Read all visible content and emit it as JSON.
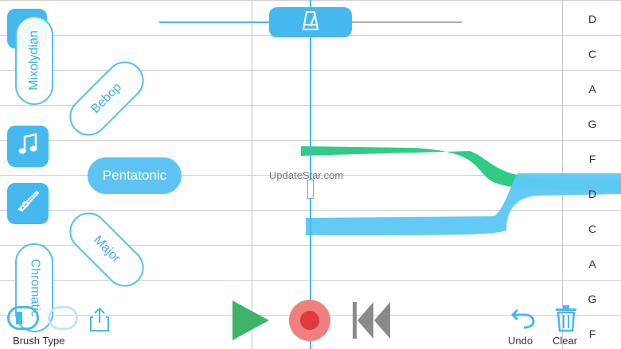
{
  "notes": [
    "D",
    "C",
    "A",
    "G",
    "F",
    "D",
    "C",
    "A",
    "G",
    "F"
  ],
  "scales": {
    "mixolydian": "Mixolydian",
    "bebop": "Bebop",
    "pentatonic": "Pentatonic",
    "major": "Major",
    "chromatic": "Chromatic"
  },
  "bottom_bar": {
    "brush_type": "Brush Type",
    "undo": "Undo",
    "clear": "Clear"
  },
  "watermark": "UpdateStar.com",
  "colors": {
    "accent": "#46b8f0",
    "green_path": "#2ecc85",
    "blue_path": "#5ec8f5",
    "play": "#3fb36a",
    "record": "#e84a4a",
    "rewind": "#8a8a8a"
  },
  "icons": {
    "home": "home-icon",
    "music": "music-note-icon",
    "trumpet": "trumpet-icon",
    "metronome": "metronome-icon",
    "share": "share-icon",
    "play": "play-icon",
    "record": "record-icon",
    "rewind": "rewind-icon",
    "undo": "undo-icon",
    "clear": "trash-icon"
  }
}
